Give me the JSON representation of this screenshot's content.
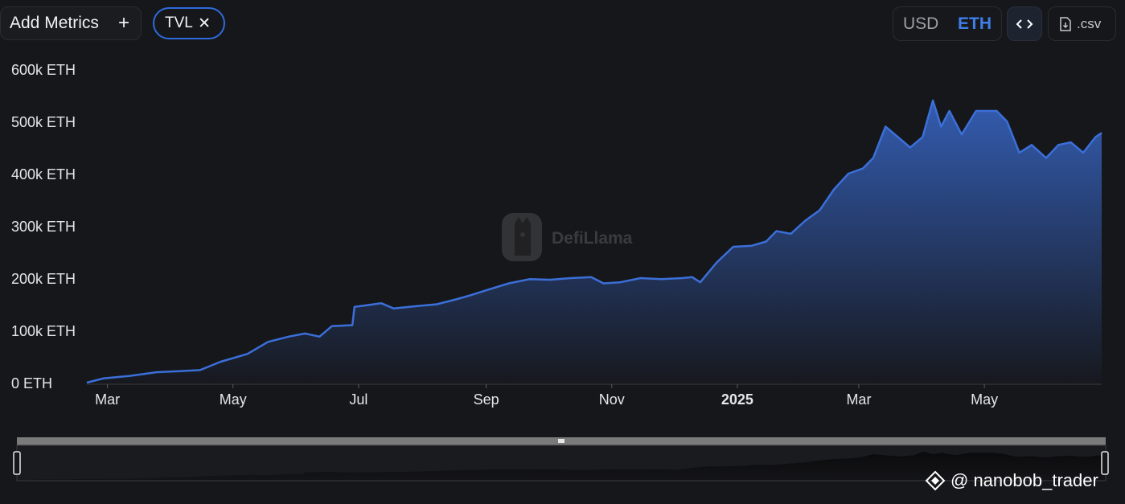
{
  "toolbar": {
    "add_metrics_label": "Add Metrics",
    "add_metrics_icon": "plus-icon",
    "metric_chip_label": "TVL",
    "metric_chip_icon": "close-icon",
    "currency_options": [
      "USD",
      "ETH"
    ],
    "currency_selected": "ETH",
    "embed_icon": "code-brackets-icon",
    "csv_label": ".csv",
    "csv_icon": "file-download-icon"
  },
  "colors": {
    "background": "#16171b",
    "line": "#3b6fd9",
    "accent": "#3f7ee8",
    "axis_text": "#e6e6e6"
  },
  "logo": {
    "text": "DefiLlama"
  },
  "watermark": {
    "text": "@ nanobob_trader"
  },
  "chart_data": {
    "type": "area",
    "title": "",
    "xlabel": "",
    "ylabel": "",
    "ylim": [
      0,
      600000
    ],
    "y_ticks": [
      0,
      100000,
      200000,
      300000,
      400000,
      500000,
      600000
    ],
    "y_tick_labels": [
      "0 ETH",
      "100k ETH",
      "200k ETH",
      "300k ETH",
      "400k ETH",
      "500k ETH",
      "600k ETH"
    ],
    "x_range": [
      "2024-02-20",
      "2025-06-27"
    ],
    "x_ticks": [
      {
        "date": "2024-03-01",
        "label": "Mar",
        "bold": false
      },
      {
        "date": "2024-05-01",
        "label": "May",
        "bold": false
      },
      {
        "date": "2024-07-01",
        "label": "Jul",
        "bold": false
      },
      {
        "date": "2024-09-01",
        "label": "Sep",
        "bold": false
      },
      {
        "date": "2024-11-01",
        "label": "Nov",
        "bold": false
      },
      {
        "date": "2025-01-01",
        "label": "2025",
        "bold": true
      },
      {
        "date": "2025-03-01",
        "label": "Mar",
        "bold": false
      },
      {
        "date": "2025-05-01",
        "label": "May",
        "bold": false
      }
    ],
    "grid": false,
    "legend": "none",
    "series": [
      {
        "name": "TVL",
        "points": [
          [
            "2024-02-20",
            0
          ],
          [
            "2024-02-28",
            8000
          ],
          [
            "2024-03-12",
            13000
          ],
          [
            "2024-03-25",
            20000
          ],
          [
            "2024-04-05",
            22000
          ],
          [
            "2024-04-15",
            24000
          ],
          [
            "2024-04-25",
            40000
          ],
          [
            "2024-05-08",
            55000
          ],
          [
            "2024-05-18",
            78000
          ],
          [
            "2024-05-28",
            88000
          ],
          [
            "2024-06-05",
            94000
          ],
          [
            "2024-06-12",
            88000
          ],
          [
            "2024-06-18",
            108000
          ],
          [
            "2024-06-28",
            110000
          ],
          [
            "2024-06-29",
            145000
          ],
          [
            "2024-07-05",
            148000
          ],
          [
            "2024-07-12",
            152000
          ],
          [
            "2024-07-18",
            142000
          ],
          [
            "2024-07-28",
            146000
          ],
          [
            "2024-08-08",
            150000
          ],
          [
            "2024-08-18",
            160000
          ],
          [
            "2024-08-25",
            168000
          ],
          [
            "2024-09-02",
            178000
          ],
          [
            "2024-09-12",
            190000
          ],
          [
            "2024-09-22",
            198000
          ],
          [
            "2024-10-02",
            197000
          ],
          [
            "2024-10-12",
            200000
          ],
          [
            "2024-10-22",
            202000
          ],
          [
            "2024-10-28",
            190000
          ],
          [
            "2024-11-05",
            192000
          ],
          [
            "2024-11-15",
            200000
          ],
          [
            "2024-11-25",
            198000
          ],
          [
            "2024-12-05",
            200000
          ],
          [
            "2024-12-10",
            202000
          ],
          [
            "2024-12-14",
            192000
          ],
          [
            "2024-12-22",
            230000
          ],
          [
            "2024-12-30",
            260000
          ],
          [
            "2025-01-08",
            262000
          ],
          [
            "2025-01-15",
            270000
          ],
          [
            "2025-01-20",
            290000
          ],
          [
            "2025-01-27",
            285000
          ],
          [
            "2025-02-03",
            310000
          ],
          [
            "2025-02-10",
            330000
          ],
          [
            "2025-02-17",
            370000
          ],
          [
            "2025-02-24",
            400000
          ],
          [
            "2025-03-03",
            410000
          ],
          [
            "2025-03-08",
            430000
          ],
          [
            "2025-03-14",
            490000
          ],
          [
            "2025-03-20",
            470000
          ],
          [
            "2025-03-26",
            450000
          ],
          [
            "2025-04-01",
            470000
          ],
          [
            "2025-04-06",
            540000
          ],
          [
            "2025-04-10",
            490000
          ],
          [
            "2025-04-14",
            520000
          ],
          [
            "2025-04-20",
            475000
          ],
          [
            "2025-04-27",
            520000
          ],
          [
            "2025-05-07",
            520000
          ],
          [
            "2025-05-12",
            500000
          ],
          [
            "2025-05-18",
            440000
          ],
          [
            "2025-05-24",
            455000
          ],
          [
            "2025-05-31",
            430000
          ],
          [
            "2025-06-06",
            455000
          ],
          [
            "2025-06-12",
            460000
          ],
          [
            "2025-06-18",
            440000
          ],
          [
            "2025-06-24",
            470000
          ],
          [
            "2025-06-27",
            478000
          ]
        ]
      }
    ]
  }
}
